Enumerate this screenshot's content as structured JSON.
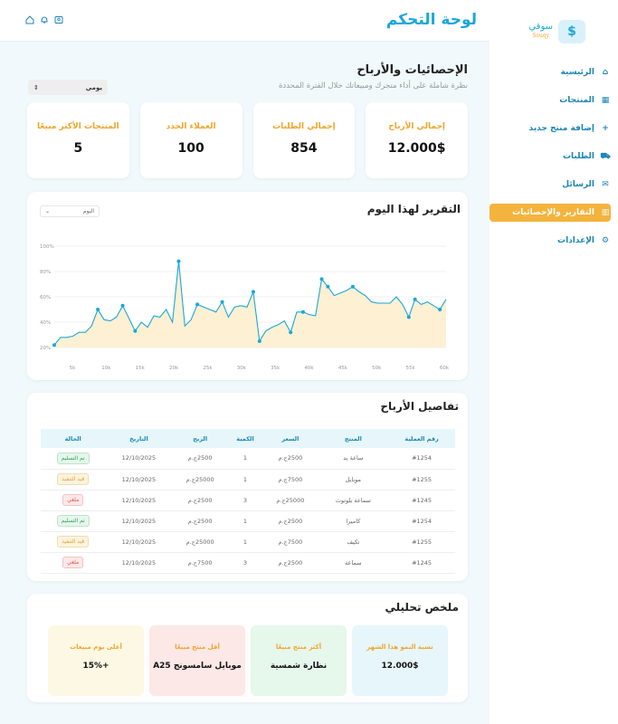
{
  "brand": {
    "name": "سوقي",
    "sub": "Souqy",
    "logo_glyph": "$"
  },
  "sidebar": {
    "items": [
      {
        "label": "الرئيسية",
        "icon": "home-icon",
        "glyph": "⌂",
        "active": false
      },
      {
        "label": "المنتجات",
        "icon": "grid-icon",
        "glyph": "▦",
        "active": false
      },
      {
        "label": "إضافة منتج جديد",
        "icon": "plus-icon",
        "glyph": "+",
        "active": false
      },
      {
        "label": "الطلبات",
        "icon": "truck-icon",
        "glyph": "⛟",
        "active": false
      },
      {
        "label": "الرسائل",
        "icon": "chat-icon",
        "glyph": "✉",
        "active": false
      },
      {
        "label": "التقارير والإحصائيات",
        "icon": "chart-icon",
        "glyph": "▥",
        "active": true
      },
      {
        "label": "الإعدادات",
        "icon": "gear-icon",
        "glyph": "⚙",
        "active": false
      }
    ]
  },
  "header": {
    "title": "لوحة التحكم"
  },
  "stats": {
    "title": "الإحصائيات والأرباح",
    "subtitle": "نظرة شاملة على أداء متجرك ومبيعاتك خلال الفترة المحددة",
    "period": "يومي",
    "cards": [
      {
        "label": "إجمالي الأرباح",
        "value": "12.000$"
      },
      {
        "label": "إجمالي الطلبات",
        "value": "854"
      },
      {
        "label": "العملاء الجدد",
        "value": "100"
      },
      {
        "label": "المنتجات الأكثر مبيعًا",
        "value": "5"
      }
    ]
  },
  "chart": {
    "title": "التقرير لهذا اليوم",
    "select_value": "اليوم"
  },
  "chart_data": {
    "type": "area",
    "title": "التقرير لهذا اليوم",
    "xlabel": "",
    "ylabel": "",
    "x_ticks": [
      "5k",
      "10k",
      "15k",
      "20k",
      "25k",
      "30k",
      "35k",
      "40k",
      "45k",
      "50k",
      "55k",
      "60k"
    ],
    "y_ticks": [
      "20%",
      "40%",
      "60%",
      "80%",
      "100%"
    ],
    "xlim": [
      0,
      62
    ],
    "ylim": [
      20,
      100
    ],
    "color_line": "#1aa7d9",
    "color_fill": "#fdf0d3",
    "x": [
      0,
      1,
      2,
      3,
      4,
      5,
      6,
      7,
      8,
      9,
      10,
      11,
      12,
      13,
      14,
      15,
      16,
      17,
      18,
      19,
      20,
      21,
      22,
      23,
      24,
      25,
      26,
      27,
      28,
      29,
      30,
      31,
      32,
      33,
      34,
      35,
      36,
      37,
      38,
      39,
      40,
      41,
      42,
      43,
      44,
      45,
      46,
      47,
      48,
      49,
      50,
      51,
      52,
      53,
      54,
      55,
      56,
      57,
      58,
      59,
      60,
      61
    ],
    "y": [
      22,
      28,
      28,
      29,
      32,
      32,
      37,
      50,
      42,
      41,
      44,
      53,
      43,
      33,
      40,
      36,
      45,
      44,
      50,
      40,
      88,
      37,
      42,
      54,
      52,
      50,
      48,
      56,
      44,
      52,
      53,
      52,
      64,
      25,
      33,
      36,
      38,
      41,
      32,
      48,
      48,
      46,
      45,
      74,
      68,
      61,
      63,
      65,
      68,
      64,
      61,
      56,
      55,
      55,
      55,
      60,
      54,
      44,
      58,
      54,
      56,
      53,
      50,
      58
    ]
  },
  "profits": {
    "title": "تفاصيل الأرباح",
    "headers": [
      "رقم العملية",
      "المنتج",
      "السعر",
      "الكمية",
      "الربح",
      "التاريخ",
      "الحالة"
    ],
    "rows": [
      [
        "#1254",
        "ساعة يد",
        "2500ج.م",
        "1",
        "2500ج.م",
        "12/10/2025",
        "تم التسليم"
      ],
      [
        "#1255",
        "موبايل",
        "7500ج.م",
        "1",
        "25000ج.م",
        "12/10/2025",
        "قيد التنفيذ"
      ],
      [
        "#1245",
        "سماعة بلوتوث",
        "25000ج.م",
        "3",
        "2500ج.م",
        "12/10/2025",
        "ملغي"
      ],
      [
        "#1254",
        "كاميرا",
        "2500ج.م",
        "1",
        "2500ج.م",
        "12/10/2025",
        "تم التسليم"
      ],
      [
        "#1255",
        "تكيف",
        "7500ج.م",
        "1",
        "25000ج.م",
        "12/10/2025",
        "قيد التنفيذ"
      ],
      [
        "#1245",
        "سماعة",
        "2500ج.م",
        "3",
        "7500ج.م",
        "12/10/2025",
        "ملغي"
      ]
    ]
  },
  "summary": {
    "title": "ملخص تحليلي",
    "cards": [
      {
        "label": "نسبة النمو هذا الشهر",
        "value": "12.000$",
        "bg": "#e6f6fb"
      },
      {
        "label": "أكثر منتج مبيعًا",
        "value": "نظارة شمسية",
        "bg": "#e6f7ec"
      },
      {
        "label": "أقل منتج مبيعًا",
        "value": "موبايل سامسونج A25",
        "bg": "#fde8e8"
      },
      {
        "label": "أعلى يوم مبيعات",
        "value": "+15%",
        "bg": "#fdf8e4"
      }
    ]
  }
}
